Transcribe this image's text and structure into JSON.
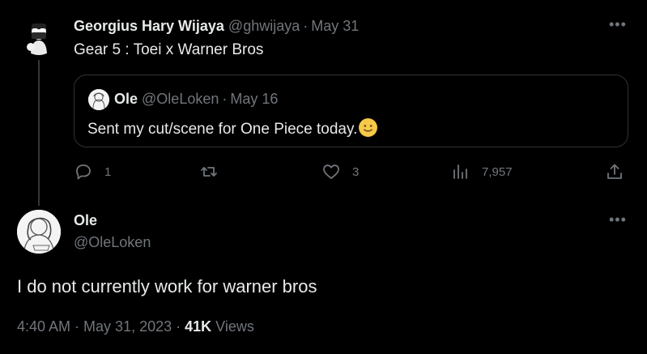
{
  "parent": {
    "name": "Georgius Hary Wijaya",
    "handle": "@ghwijaya",
    "separator": "·",
    "date": "May 31",
    "more": "•••",
    "text": "Gear 5 : Toei x Warner Bros",
    "quote": {
      "name": "Ole",
      "handle": "@OleLoken",
      "separator": "·",
      "date": "May 16",
      "text": "Sent my cut/scene for One Piece today."
    },
    "actions": {
      "replies": "1",
      "retweets": "",
      "likes": "3",
      "views": "7,957"
    }
  },
  "main": {
    "name": "Ole",
    "handle": "@OleLoken",
    "more": "•••",
    "text": "I do not currently work for warner bros",
    "time": "4:40 AM",
    "separator": "·",
    "date": "May 31, 2023",
    "separator2": "·",
    "views_count": "41K",
    "views_label": "Views"
  },
  "colors": {
    "background": "#000000",
    "text": "#e7e9ea",
    "muted": "#71767b",
    "border": "#2f3336",
    "emoji": "#f7c948"
  },
  "icons": {
    "reply": "reply-icon",
    "retweet": "retweet-icon",
    "like": "heart-icon",
    "views": "views-icon",
    "share": "share-icon",
    "more": "more-icon",
    "emoji": "slightly-smiling-face-emoji"
  }
}
